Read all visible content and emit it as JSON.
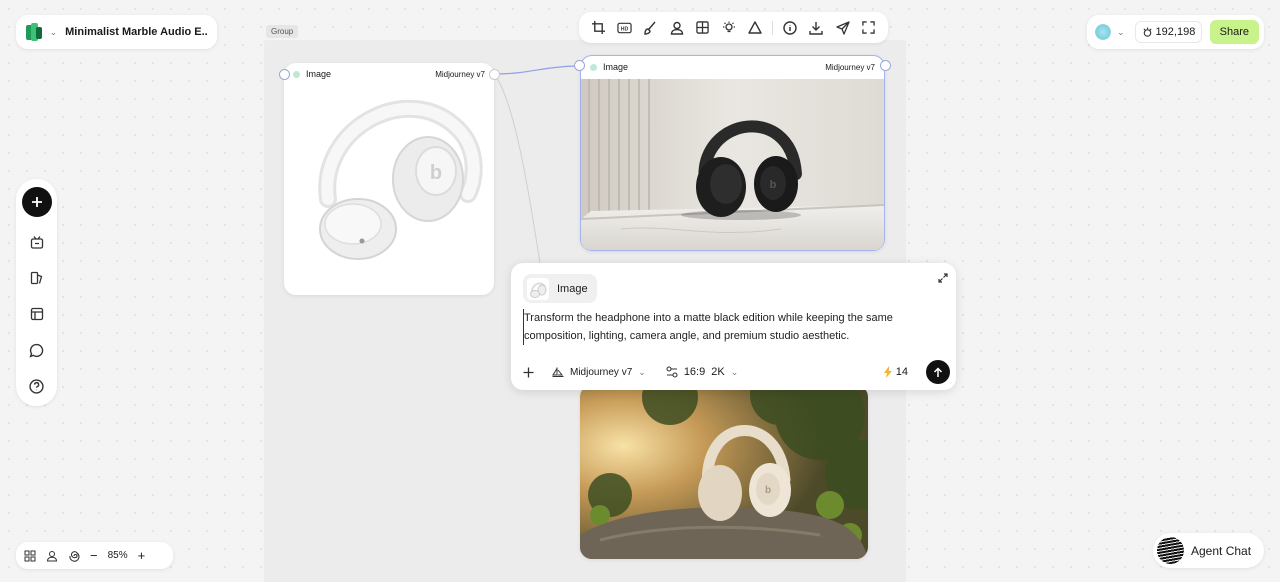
{
  "project": {
    "title": "Minimalist Marble Audio E..."
  },
  "group": {
    "label": "Group"
  },
  "credits": {
    "value": "192,198"
  },
  "share": {
    "label": "Share"
  },
  "nodes": [
    {
      "label": "Image",
      "model": "Midjourney v7"
    },
    {
      "label": "Image",
      "model": "Midjourney v7"
    }
  ],
  "prompt": {
    "ref_label": "Image",
    "text": "Transform the headphone into a matte black edition while keeping the same composition, lighting, camera angle, and premium studio aesthetic.",
    "model": "Midjourney v7",
    "aspect": "16:9",
    "resolution": "2K",
    "cost": "14"
  },
  "zoom": {
    "value": "85%"
  },
  "agent_chat": {
    "label": "Agent Chat"
  },
  "colors": {
    "accent_green": "#c8f38a",
    "node_border": "#a4b2f0"
  }
}
